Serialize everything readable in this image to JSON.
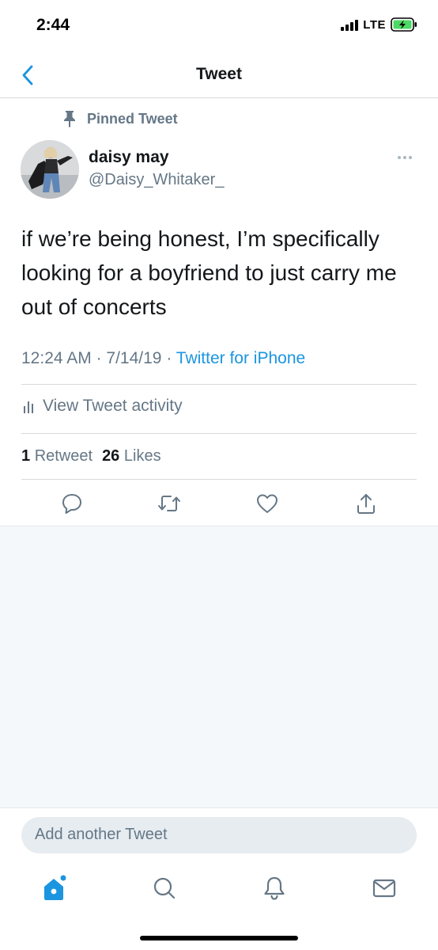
{
  "status_bar": {
    "time": "2:44",
    "network": "LTE"
  },
  "nav": {
    "title": "Tweet"
  },
  "tweet": {
    "pinned_label": "Pinned Tweet",
    "author_name": "daisy may",
    "author_handle": "@Daisy_Whitaker_",
    "text": "if we’re being honest, I’m specifically looking for a boyfriend to just carry me out of concerts",
    "time": "12:24 AM",
    "date": "7/14/19",
    "source": "Twitter for iPhone",
    "activity_label": "View Tweet activity",
    "retweet_count": "1",
    "retweet_label": "Retweet",
    "like_count": "26",
    "like_label": "Likes"
  },
  "compose": {
    "placeholder": "Add another Tweet"
  },
  "tab_bar": {
    "items": [
      "home-icon",
      "search-icon",
      "notifications-icon",
      "messages-icon"
    ]
  },
  "colors": {
    "accent": "#1b95e0",
    "secondary_text": "#657786",
    "divider": "#d6d9dc",
    "background_gray": "#f5f8fa"
  }
}
